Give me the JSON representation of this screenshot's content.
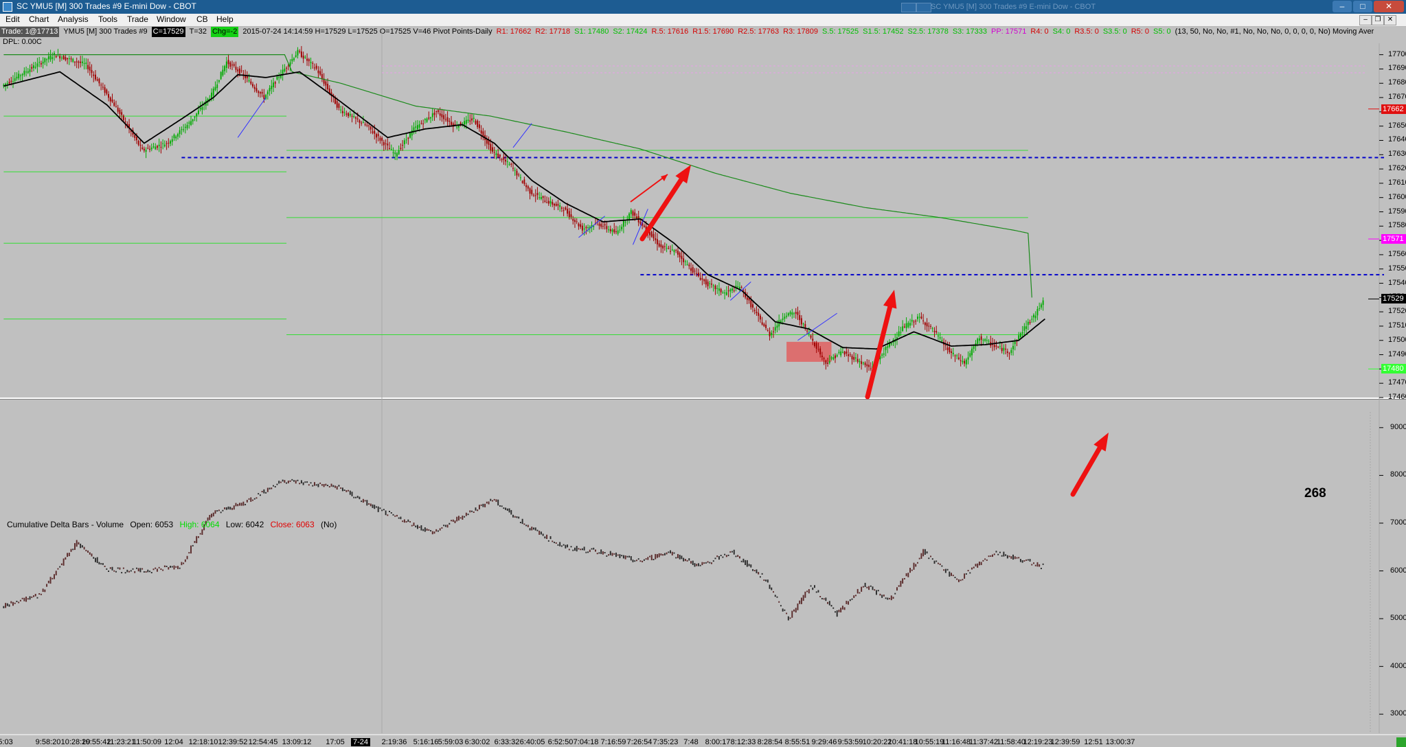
{
  "window": {
    "title": "SC YMU5 [M]  300 Trades  #9  E-mini Dow - CBOT",
    "ghost_text": "SC YMU5 [M] 300 Trades  #9  E-mini Dow - CBOT",
    "buttons": [
      "minimize",
      "maximize",
      "close"
    ]
  },
  "menu": [
    "Edit",
    "Chart",
    "Analysis",
    "Tools",
    "Trade",
    "Window",
    "CB",
    "Help"
  ],
  "infobar": {
    "items": [
      {
        "text": "Trade: 1@17713",
        "style": "chip"
      },
      {
        "text": "YMU5 [M]  300 Trades  #9",
        "style": "plain"
      },
      {
        "text": "C=17529",
        "style": "chip-black"
      },
      {
        "text": "T=32",
        "style": "plain"
      },
      {
        "text": "Chg=-2",
        "style": "chip-green"
      },
      {
        "text": "2015-07-24 14:14:59 H=17529 L=17525 O=17525 V=46 Pivot Points-Daily",
        "style": "plain"
      },
      {
        "text": "R1: 17662",
        "color": "#d40000"
      },
      {
        "text": "R2: 17718",
        "color": "#d40000"
      },
      {
        "text": "S1: 17480",
        "color": "#00c000"
      },
      {
        "text": "S2: 17424",
        "color": "#00c000"
      },
      {
        "text": "R.5: 17616",
        "color": "#d40000"
      },
      {
        "text": "R1.5: 17690",
        "color": "#d40000"
      },
      {
        "text": "R2.5: 17763",
        "color": "#d40000"
      },
      {
        "text": "R3: 17809",
        "color": "#d40000"
      },
      {
        "text": "S.5: 17525",
        "color": "#00c000"
      },
      {
        "text": "S1.5: 17452",
        "color": "#00c000"
      },
      {
        "text": "S2.5: 17378",
        "color": "#00c000"
      },
      {
        "text": "S3: 17333",
        "color": "#00c000"
      },
      {
        "text": "PP: 17571",
        "color": "#d000d0"
      },
      {
        "text": "R4: 0",
        "color": "#d40000"
      },
      {
        "text": "S4: 0",
        "color": "#00c000"
      },
      {
        "text": "R3.5: 0",
        "color": "#d40000"
      },
      {
        "text": "S3.5: 0",
        "color": "#00c000"
      },
      {
        "text": "R5: 0",
        "color": "#d40000"
      },
      {
        "text": "S5: 0",
        "color": "#00c000"
      },
      {
        "text": "(13, 50, No, No, #1, No, No, No, 0, 0, 0, 0, No)  Moving Aver",
        "style": "plain"
      }
    ],
    "dpl": "DPL: 0.00C"
  },
  "price_axis": {
    "ticks": [
      17700,
      17690,
      17680,
      17670,
      17660,
      17650,
      17640,
      17630,
      17620,
      17610,
      17600,
      17590,
      17580,
      17570,
      17560,
      17550,
      17540,
      17530,
      17520,
      17510,
      17500,
      17490,
      17480,
      17470,
      17460
    ],
    "badges": [
      {
        "text": "17662",
        "value": 17662,
        "bg": "#e01010",
        "fg": "#ffffff"
      },
      {
        "text": "17571",
        "value": 17571,
        "bg": "#ff00ff",
        "fg": "#ffffff"
      },
      {
        "text": "17529",
        "value": 17529,
        "bg": "#000000",
        "fg": "#ffffff"
      },
      {
        "text": "17480",
        "value": 17480,
        "bg": "#33ff33",
        "fg": "#ffffff"
      }
    ]
  },
  "volume_axis": {
    "ticks": [
      9000,
      8000,
      7000,
      6000,
      5000,
      4000,
      3000
    ]
  },
  "time_axis": {
    "labels": [
      {
        "text": "5:03",
        "x": 0.0
      },
      {
        "text": "9:58:20",
        "x": 0.0
      },
      {
        "text": "10:28:29",
        "x": 0.0
      },
      {
        "text": "10:55:42",
        "x": 0.0
      },
      {
        "text": "11:23:21",
        "x": 0.0
      },
      {
        "text": "11:50:09",
        "x": 0.0
      },
      {
        "text": "12:04",
        "x": 0.0
      },
      {
        "text": "12:18:10",
        "x": 0.0
      },
      {
        "text": "12:39:52",
        "x": 0.0
      },
      {
        "text": "12:54:45",
        "x": 0.0
      },
      {
        "text": "13:09:12",
        "x": 0.0
      },
      {
        "text": "17:05",
        "x": 0.0
      },
      {
        "text": "7-24",
        "x": 0.0,
        "highlight": true
      },
      {
        "text": "2:19:36",
        "x": 0.0
      },
      {
        "text": "5:16:16",
        "x": 0.0
      },
      {
        "text": "5:59:03",
        "x": 0.0
      },
      {
        "text": "6:30:02",
        "x": 0.0
      },
      {
        "text": "6:33:32",
        "x": 0.0
      },
      {
        "text": "6:40:05",
        "x": 0.0
      },
      {
        "text": "6:52:50",
        "x": 0.0
      },
      {
        "text": "7:04:18",
        "x": 0.0
      },
      {
        "text": "7:16:59",
        "x": 0.0
      },
      {
        "text": "7:26:54",
        "x": 0.0
      },
      {
        "text": "7:35:23",
        "x": 0.0
      },
      {
        "text": "7:48",
        "x": 0.0
      },
      {
        "text": "8:00:17",
        "x": 0.0
      },
      {
        "text": "8:12:33",
        "x": 0.0
      },
      {
        "text": "8:28:54",
        "x": 0.0
      },
      {
        "text": "8:55:51",
        "x": 0.0
      },
      {
        "text": "9:29:46",
        "x": 0.0
      },
      {
        "text": "9:53:59",
        "x": 0.0
      },
      {
        "text": "10:20:22",
        "x": 0.0
      },
      {
        "text": "10:41:18",
        "x": 0.0
      },
      {
        "text": "10:55:19",
        "x": 0.0
      },
      {
        "text": "11:16:48",
        "x": 0.0
      },
      {
        "text": "11:37:42",
        "x": 0.0
      },
      {
        "text": "11:58:40",
        "x": 0.0
      },
      {
        "text": "12:19:23",
        "x": 0.0
      },
      {
        "text": "12:39:59",
        "x": 0.0
      },
      {
        "text": "12:51",
        "x": 0.0
      },
      {
        "text": "13:00:37",
        "x": 0.0
      }
    ]
  },
  "subgraph": {
    "name": "Cumulative Delta Bars - Volume",
    "open": "Open: 6053",
    "high": "High: 6064",
    "low": "Low: 6042",
    "close": "Close: 6063",
    "extra": "(No)"
  },
  "annotation": {
    "count_text": "268"
  },
  "colors": {
    "background": "#c0c0c0",
    "up_candle": "#00aa00",
    "down_candle": "#a00000",
    "ma_fast": "#000000",
    "ma_slow": "#1a8a1a",
    "pivot_lines": "#33dd33",
    "dashed_level": "#0000cc",
    "arrows": "#ee1111"
  },
  "chart_data": [
    {
      "type": "candlestick",
      "title": "YMU5 [M] 300 Trades #9",
      "y_unit": "price",
      "ylim": [
        17460,
        17708
      ],
      "close_path_keypoints": [
        [
          0,
          17678
        ],
        [
          15,
          17690
        ],
        [
          28,
          17700
        ],
        [
          45,
          17693
        ],
        [
          60,
          17665
        ],
        [
          75,
          17633
        ],
        [
          88,
          17638
        ],
        [
          100,
          17652
        ],
        [
          112,
          17672
        ],
        [
          120,
          17695
        ],
        [
          128,
          17687
        ],
        [
          140,
          17670
        ],
        [
          148,
          17685
        ],
        [
          158,
          17702
        ],
        [
          168,
          17690
        ],
        [
          180,
          17662
        ],
        [
          195,
          17650
        ],
        [
          210,
          17630
        ],
        [
          220,
          17648
        ],
        [
          232,
          17660
        ],
        [
          242,
          17650
        ],
        [
          252,
          17655
        ],
        [
          262,
          17632
        ],
        [
          272,
          17622
        ],
        [
          282,
          17604
        ],
        [
          290,
          17598
        ],
        [
          300,
          17592
        ],
        [
          310,
          17578
        ],
        [
          318,
          17582
        ],
        [
          328,
          17575
        ],
        [
          336,
          17590
        ],
        [
          344,
          17578
        ],
        [
          352,
          17565
        ],
        [
          360,
          17562
        ],
        [
          368,
          17550
        ],
        [
          376,
          17540
        ],
        [
          386,
          17533
        ],
        [
          394,
          17538
        ],
        [
          402,
          17520
        ],
        [
          410,
          17504
        ],
        [
          418,
          17518
        ],
        [
          424,
          17519
        ],
        [
          432,
          17502
        ],
        [
          440,
          17484
        ],
        [
          448,
          17492
        ],
        [
          456,
          17487
        ],
        [
          464,
          17480
        ],
        [
          472,
          17494
        ],
        [
          482,
          17510
        ],
        [
          490,
          17516
        ],
        [
          498,
          17506
        ],
        [
          506,
          17492
        ],
        [
          514,
          17484
        ],
        [
          522,
          17502
        ],
        [
          530,
          17496
        ],
        [
          538,
          17492
        ],
        [
          546,
          17509
        ],
        [
          552,
          17518
        ],
        [
          556,
          17529
        ]
      ],
      "ma_fast_keypoints": [
        [
          0,
          17678
        ],
        [
          30,
          17688
        ],
        [
          55,
          17665
        ],
        [
          75,
          17638
        ],
        [
          95,
          17655
        ],
        [
          112,
          17670
        ],
        [
          125,
          17686
        ],
        [
          140,
          17684
        ],
        [
          158,
          17688
        ],
        [
          180,
          17667
        ],
        [
          205,
          17642
        ],
        [
          225,
          17648
        ],
        [
          245,
          17651
        ],
        [
          262,
          17638
        ],
        [
          282,
          17612
        ],
        [
          300,
          17596
        ],
        [
          320,
          17583
        ],
        [
          340,
          17585
        ],
        [
          358,
          17568
        ],
        [
          376,
          17546
        ],
        [
          394,
          17535
        ],
        [
          412,
          17513
        ],
        [
          430,
          17508
        ],
        [
          448,
          17495
        ],
        [
          466,
          17494
        ],
        [
          486,
          17506
        ],
        [
          506,
          17496
        ],
        [
          524,
          17497
        ],
        [
          542,
          17500
        ],
        [
          556,
          17515
        ]
      ],
      "ma_slow_keypoints": [
        [
          0,
          17700
        ],
        [
          150,
          17700
        ],
        [
          154,
          17688
        ],
        [
          180,
          17680
        ],
        [
          220,
          17664
        ],
        [
          260,
          17657
        ],
        [
          300,
          17646
        ],
        [
          340,
          17634
        ],
        [
          380,
          17617
        ],
        [
          420,
          17603
        ],
        [
          460,
          17593
        ],
        [
          500,
          17586
        ],
        [
          540,
          17577
        ],
        [
          547,
          17575
        ],
        [
          549,
          17530
        ]
      ],
      "pivot_levels_segments": [
        {
          "from": 0,
          "to": 151,
          "levels": [
            17657,
            17618,
            17568,
            17515
          ]
        },
        {
          "from": 151,
          "to": 547,
          "levels": [
            17633,
            17586,
            17504
          ]
        }
      ],
      "dashed_levels": [
        {
          "from": 95,
          "to": 556,
          "value": 17628
        },
        {
          "from": 340,
          "to": 556,
          "value": 17546
        }
      ],
      "highlight_box": {
        "from": 418,
        "to": 442,
        "y_min": 17485,
        "y_max": 17499
      },
      "sticky_labels": {
        "17700": "17700",
        "17570": "17570",
        "17550": "17550"
      }
    },
    {
      "type": "bar",
      "title": "Cumulative Delta Bars - Volume",
      "ylim": [
        2600,
        9400
      ],
      "keypoints": [
        [
          0,
          5250
        ],
        [
          20,
          5500
        ],
        [
          40,
          6600
        ],
        [
          55,
          6050
        ],
        [
          75,
          6000
        ],
        [
          95,
          6100
        ],
        [
          112,
          7200
        ],
        [
          128,
          7400
        ],
        [
          150,
          7900
        ],
        [
          180,
          7750
        ],
        [
          200,
          7300
        ],
        [
          230,
          6800
        ],
        [
          262,
          7500
        ],
        [
          282,
          6900
        ],
        [
          300,
          6500
        ],
        [
          320,
          6400
        ],
        [
          340,
          6200
        ],
        [
          356,
          6400
        ],
        [
          372,
          6100
        ],
        [
          390,
          6400
        ],
        [
          408,
          5800
        ],
        [
          420,
          5000
        ],
        [
          432,
          5700
        ],
        [
          446,
          5100
        ],
        [
          460,
          5700
        ],
        [
          474,
          5400
        ],
        [
          492,
          6400
        ],
        [
          510,
          5800
        ],
        [
          530,
          6400
        ],
        [
          556,
          6100
        ]
      ]
    }
  ]
}
